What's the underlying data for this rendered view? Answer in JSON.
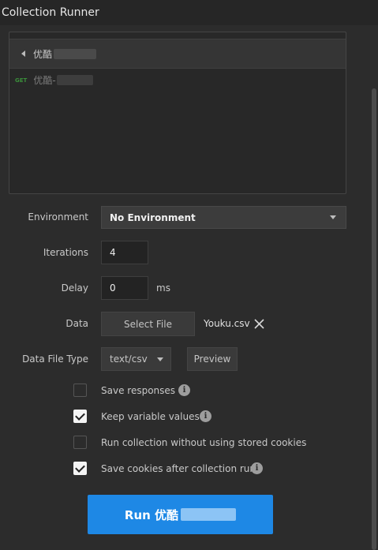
{
  "window": {
    "title": "Collection Runner"
  },
  "collection": {
    "folder_name": "优酷",
    "requests": [
      {
        "method": "GET",
        "name": "优酷-"
      }
    ]
  },
  "form": {
    "environment": {
      "label": "Environment",
      "value": "No Environment"
    },
    "iterations": {
      "label": "Iterations",
      "value": "4"
    },
    "delay": {
      "label": "Delay",
      "value": "0",
      "unit": "ms"
    },
    "data": {
      "label": "Data",
      "button": "Select File",
      "file_name": "Youku.csv"
    },
    "data_file_type": {
      "label": "Data File Type",
      "value": "text/csv",
      "preview_button": "Preview"
    }
  },
  "options": [
    {
      "label": "Save responses",
      "checked": false,
      "info": true
    },
    {
      "label": "Keep variable values",
      "checked": true,
      "info": true
    },
    {
      "label": "Run collection without using stored cookies",
      "checked": false,
      "info": false
    },
    {
      "label": "Save cookies after collection run",
      "checked": true,
      "info": true
    }
  ],
  "run_button": {
    "label": "Run 优酷"
  },
  "colors": {
    "accent": "#1e88e5",
    "background": "#2c2c2c",
    "method_get": "#3a8f3a"
  }
}
